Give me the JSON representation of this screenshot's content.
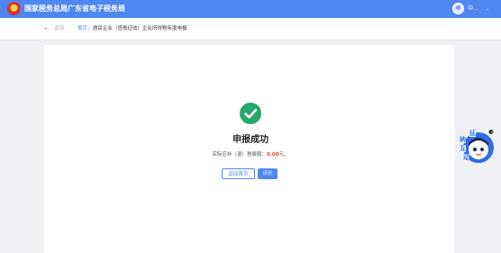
{
  "header": {
    "site_title": "国家税务总局广东省电子税务局",
    "user_name": "中...",
    "caret": "⌄"
  },
  "breadcrumb": {
    "back_arrow": "←",
    "back_label": "返回",
    "home": "首页",
    "separator": "/",
    "current": "居民企业（查账征收）企业所得税年度申报"
  },
  "result": {
    "title": "申报成功",
    "prefix": "实际应补（退）税费额：",
    "amount": "0.00",
    "unit": "元。"
  },
  "buttons": {
    "home": "返回首页",
    "evaluate": "评价"
  },
  "assistant": {
    "chars": [
      "征",
      "纳",
      "互",
      "动"
    ]
  },
  "colors": {
    "brand": "#4f86f0",
    "success": "#22a96b",
    "amount": "#e03b2c"
  }
}
